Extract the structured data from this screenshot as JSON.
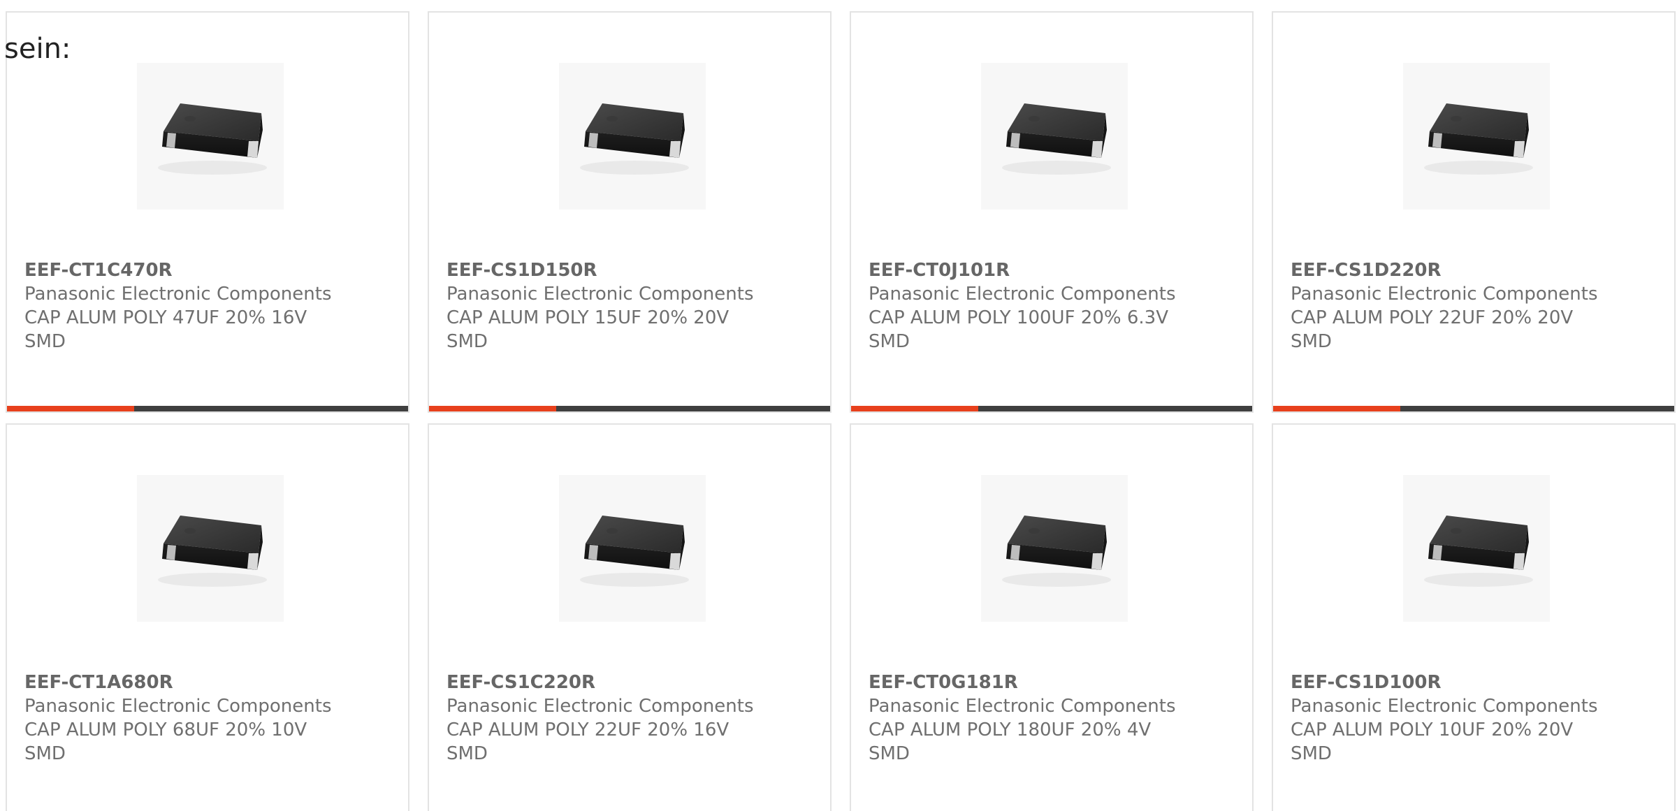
{
  "intro_text": "sein:",
  "colors": {
    "accent": "#e8401c",
    "bar": "#3f3f3f",
    "border": "#e3e3e3",
    "text": "#666666"
  },
  "products": [
    {
      "part": "EEF-CT1C470R",
      "manufacturer": "Panasonic Electronic Components",
      "description": "CAP ALUM POLY 47UF 20% 16V SMD",
      "image_icon": "smd-capacitor-image"
    },
    {
      "part": "EEF-CS1D150R",
      "manufacturer": "Panasonic Electronic Components",
      "description": "CAP ALUM POLY 15UF 20% 20V SMD",
      "image_icon": "smd-capacitor-image"
    },
    {
      "part": "EEF-CT0J101R",
      "manufacturer": "Panasonic Electronic Components",
      "description": "CAP ALUM POLY 100UF 20% 6.3V SMD",
      "image_icon": "smd-capacitor-image"
    },
    {
      "part": "EEF-CS1D220R",
      "manufacturer": "Panasonic Electronic Components",
      "description": "CAP ALUM POLY 22UF 20% 20V SMD",
      "image_icon": "smd-capacitor-image"
    },
    {
      "part": "EEF-CT1A680R",
      "manufacturer": "Panasonic Electronic Components",
      "description": "CAP ALUM POLY 68UF 20% 10V SMD",
      "image_icon": "smd-capacitor-image"
    },
    {
      "part": "EEF-CS1C220R",
      "manufacturer": "Panasonic Electronic Components",
      "description": "CAP ALUM POLY 22UF 20% 16V SMD",
      "image_icon": "smd-capacitor-image"
    },
    {
      "part": "EEF-CT0G181R",
      "manufacturer": "Panasonic Electronic Components",
      "description": "CAP ALUM POLY 180UF 20% 4V SMD",
      "image_icon": "smd-capacitor-image"
    },
    {
      "part": "EEF-CS1D100R",
      "manufacturer": "Panasonic Electronic Components",
      "description": "CAP ALUM POLY 10UF 20% 20V SMD",
      "image_icon": "smd-capacitor-image"
    }
  ]
}
